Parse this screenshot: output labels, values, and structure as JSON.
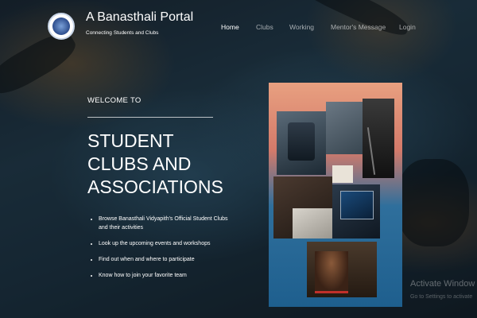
{
  "header": {
    "title": "A Banasthali Portal",
    "subtitle": "Connecting Students and Clubs",
    "logo_icon": "university-seal-icon"
  },
  "nav": {
    "items": [
      {
        "label": "Home",
        "active": true
      },
      {
        "label": "Clubs",
        "active": false
      },
      {
        "label": "Working",
        "active": false
      },
      {
        "label": "Mentor's Message",
        "active": false
      },
      {
        "label": "Login",
        "active": false
      }
    ]
  },
  "hero": {
    "welcome": "WELCOME TO",
    "headline_line1": "STUDENT",
    "headline_line2": "CLUBS AND",
    "headline_line3": "ASSOCIATIONS",
    "bullets": [
      "Browse Banasthali Vidyapith's Official Student Clubs and their activities",
      "Look up the upcoming events and workshops",
      "Find out when and where to participate",
      "Know how to join your favorite team"
    ]
  },
  "collage": {
    "description_icon": "clubs-collage-image"
  },
  "watermark": {
    "line1": "Activate Window",
    "line2": "Go to Settings to activate"
  },
  "colors": {
    "text": "#ffffff",
    "nav_inactive": "#b4b9bd",
    "background_dark": "#1a2530",
    "background_teal": "#223a4a"
  }
}
